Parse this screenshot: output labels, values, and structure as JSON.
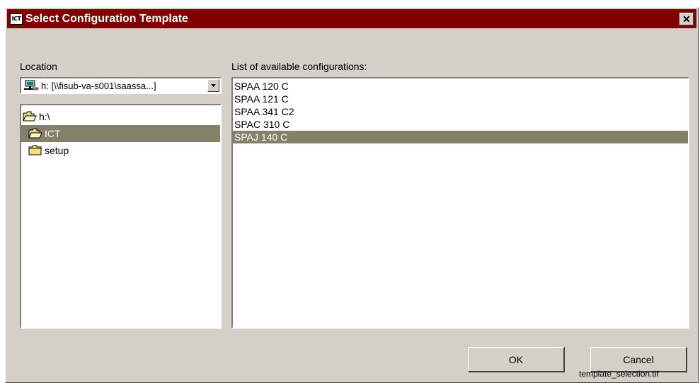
{
  "window": {
    "app_icon_text": "ICT",
    "title": "Select Configuration Template",
    "close_symbol": "✕"
  },
  "location": {
    "label": "Location",
    "drive_value": "h: [\\\\fisub-va-s001\\saassa...]",
    "drive_icon": "network-drive-icon",
    "dropdown_icon": "chevron-down-icon"
  },
  "tree": {
    "items": [
      {
        "label": "h:\\",
        "icon": "open-folder-icon",
        "selected": false
      },
      {
        "label": "ICT",
        "icon": "open-folder-icon",
        "selected": true
      },
      {
        "label": "setup",
        "icon": "folder-icon",
        "selected": false
      }
    ]
  },
  "configurations": {
    "label": "List of available configurations:",
    "items": [
      "SPAA 120 C",
      "SPAA 121 C",
      "SPAA 341 C2",
      "SPAC 310 C",
      "SPAJ 140 C"
    ],
    "selected": "SPAJ 140 C"
  },
  "buttons": {
    "ok": "OK",
    "cancel": "Cancel"
  },
  "caption": "template_selection.tif",
  "colors": {
    "titlebar": "#800000",
    "selection": "#85806a",
    "dialog_bg": "#d4d0c8"
  }
}
